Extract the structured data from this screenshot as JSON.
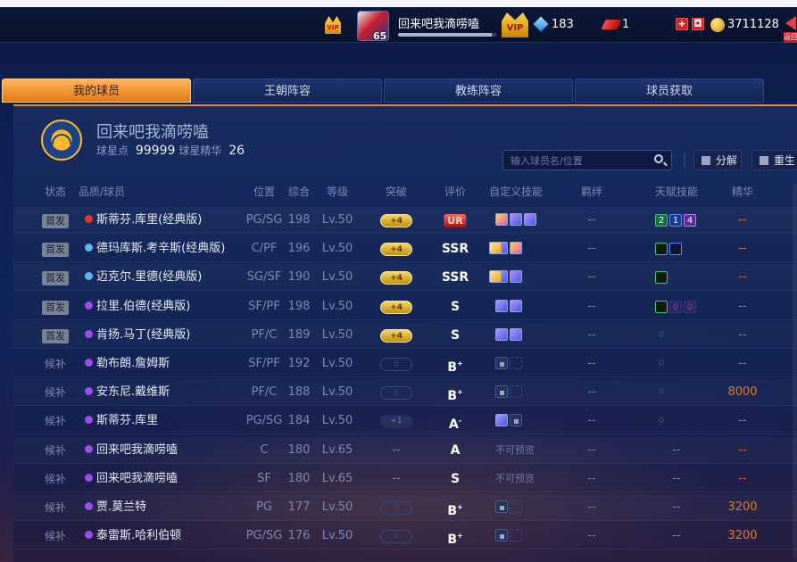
{
  "topbar": {
    "player_name": "回来吧我滴唠嗑",
    "player_level": "65",
    "vip_label": "VIP",
    "diamonds": "183",
    "tickets": "1",
    "coins": "3711128",
    "back_label": "返回",
    "progress_fraction": 0.95
  },
  "tabs": [
    "我的球员",
    "王朝阵容",
    "教练阵容",
    "球员获取"
  ],
  "team": {
    "name": "回来吧我滴唠嗑",
    "star_points_label": "球星点",
    "star_points": "99999",
    "essence_label": "球星精华",
    "essence": "26"
  },
  "search": {
    "placeholder": "输入球员名/位置"
  },
  "actions": {
    "split": "分解",
    "rebirth": "重生"
  },
  "columns": [
    "状态",
    "品质/球员",
    "位置",
    "综合",
    "等级",
    "突破",
    "评价",
    "自定义技能",
    "羁绊",
    "天赋技能",
    "精华"
  ],
  "rows": [
    {
      "status": "首发",
      "start": true,
      "quality_color": "#e5391e",
      "name": "斯蒂芬.库里(经典版)",
      "pos": "PG/SG",
      "ovr": "198",
      "lv": "Lv.50",
      "break": "+4",
      "grade": "UR",
      "skills": [
        "a",
        "b",
        "b"
      ],
      "bond": "--",
      "talents": [
        [
          "g",
          "2"
        ],
        [
          "b",
          "1"
        ],
        [
          "p",
          "4"
        ]
      ],
      "essence": "--"
    },
    {
      "status": "首发",
      "start": true,
      "quality_color": "#57b9f2",
      "name": "德玛库斯.考辛斯(经典版)",
      "pos": "C/PF",
      "ovr": "196",
      "lv": "Lv.50",
      "break": "+4",
      "grade": "SSR",
      "skills": [
        "b",
        "c",
        "a"
      ],
      "bond": "--",
      "talents": [
        [
          "blk-g",
          ""
        ],
        [
          "blk-b",
          ""
        ]
      ],
      "essence": "--"
    },
    {
      "status": "首发",
      "start": true,
      "quality_color": "#57b9f2",
      "name": "迈克尔.里德(经典版)",
      "pos": "SG/SF",
      "ovr": "190",
      "lv": "Lv.50",
      "break": "+4",
      "grade": "SSR",
      "skills": [
        "b",
        "b",
        "c"
      ],
      "bond": "--",
      "talents": [
        [
          "blk-g",
          ""
        ]
      ],
      "essence": "--"
    },
    {
      "status": "首发",
      "start": true,
      "quality_color": "#9b4de8",
      "name": "拉里.伯德(经典版)",
      "pos": "SF/PF",
      "ovr": "198",
      "lv": "Lv.50",
      "break": "+4",
      "grade": "S",
      "skills": [
        "b",
        "b"
      ],
      "bond": "--",
      "talents": [
        [
          "blk-g",
          ""
        ],
        [
          "dim-p",
          "0"
        ],
        [
          "dim-p",
          "0"
        ]
      ],
      "essence": "--"
    },
    {
      "status": "首发",
      "start": true,
      "quality_color": "#9b4de8",
      "name": "肯扬.马丁(经典版)",
      "pos": "PF/C",
      "ovr": "189",
      "lv": "Lv.50",
      "break": "+4",
      "grade": "S",
      "skills": [
        "b",
        "b"
      ],
      "bond": "--",
      "talents": [
        [
          "zero",
          "0"
        ]
      ],
      "essence": "--"
    },
    {
      "status": "候补",
      "start": false,
      "quality_color": "#9b4de8",
      "name": "勒布朗.詹姆斯",
      "pos": "SF/PF",
      "ovr": "192",
      "lv": "Lv.50",
      "break": "0",
      "grade": "B+",
      "skills": [
        "lock",
        "empty"
      ],
      "bond": "--",
      "talents": [
        [
          "zero",
          "0"
        ]
      ],
      "essence": "--"
    },
    {
      "status": "候补",
      "start": false,
      "quality_color": "#9b4de8",
      "name": "安东尼.戴维斯",
      "pos": "PF/C",
      "ovr": "188",
      "lv": "Lv.50",
      "break": "0",
      "grade": "B+",
      "skills": [
        "lock",
        "empty"
      ],
      "bond": "--",
      "talents": [
        [
          "zero",
          "0"
        ]
      ],
      "essence": "8000"
    },
    {
      "status": "候补",
      "start": false,
      "quality_color": "#9b4de8",
      "name": "斯蒂芬.库里",
      "pos": "PG/SG",
      "ovr": "184",
      "lv": "Lv.50",
      "break": "+1",
      "grade": "A-",
      "skills": [
        "b",
        "lock"
      ],
      "bond": "--",
      "talents": [
        [
          "zero",
          "0"
        ]
      ],
      "essence": "--"
    },
    {
      "status": "候补",
      "start": false,
      "quality_color": "#9b4de8",
      "name": "回来吧我滴唠嗑",
      "pos": "C",
      "ovr": "180",
      "lv": "Lv.65",
      "break": "--",
      "grade": "A",
      "skills_text": "不可预览",
      "bond": "--",
      "talents_text": "--",
      "essence": "--"
    },
    {
      "status": "候补",
      "start": false,
      "quality_color": "#9b4de8",
      "name": "回来吧我滴唠嗑",
      "pos": "SF",
      "ovr": "180",
      "lv": "Lv.65",
      "break": "--",
      "grade": "S",
      "skills_text": "不可预览",
      "bond": "--",
      "talents_text": "--",
      "essence": "--"
    },
    {
      "status": "候补",
      "start": false,
      "quality_color": "#9b4de8",
      "name": "贾.莫兰特",
      "pos": "PG",
      "ovr": "177",
      "lv": "Lv.50",
      "break": "0",
      "grade": "B+",
      "skills": [
        "lock",
        "empty"
      ],
      "bond": "--",
      "talents_text": "--",
      "essence": "3200"
    },
    {
      "status": "候补",
      "start": false,
      "quality_color": "#9b4de8",
      "name": "泰雷斯.哈利伯顿",
      "pos": "PG/SG",
      "ovr": "176",
      "lv": "Lv.50",
      "break": "0",
      "grade": "B+",
      "skills": [
        "lock",
        "empty"
      ],
      "bond": "--",
      "talents_text": "--",
      "essence": "3200"
    }
  ]
}
